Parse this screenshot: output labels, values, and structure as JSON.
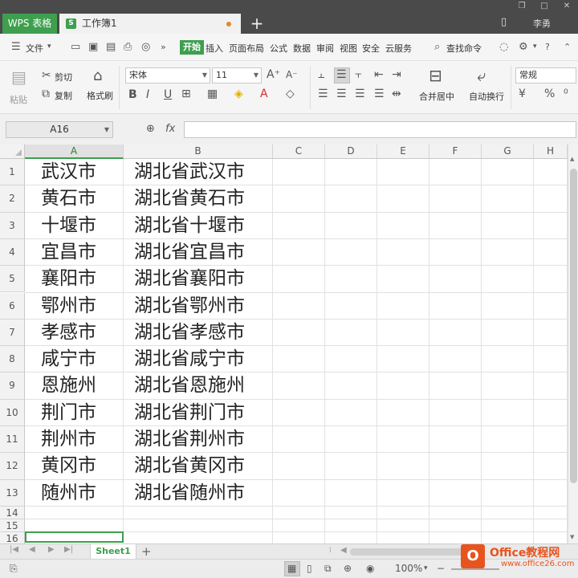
{
  "titlebar": {
    "app_tab": "WPS 表格",
    "doc_tab": "工作簿1",
    "new_tab": "+",
    "user": "李勇"
  },
  "menubar": {
    "file": "文件",
    "start": "开始",
    "items": [
      "插入",
      "页面布局",
      "公式",
      "数据",
      "审阅",
      "视图",
      "安全",
      "云服务"
    ],
    "search": "查找命令"
  },
  "ribbon": {
    "paste": "粘贴",
    "cut": "剪切",
    "copy": "复制",
    "format_painter": "格式刷",
    "font_name": "宋体",
    "font_size": "11",
    "merge_center": "合并居中",
    "wrap_text": "自动换行",
    "number_format": "常规",
    "bold": "B",
    "italic": "I",
    "underline": "U",
    "percent": "%"
  },
  "formulabar": {
    "name_box": "A16",
    "fx": "fx",
    "value": ""
  },
  "sheet": {
    "columns": [
      "A",
      "B",
      "C",
      "D",
      "E",
      "F",
      "G",
      "H"
    ],
    "rows": [
      "1",
      "2",
      "3",
      "4",
      "5",
      "6",
      "7",
      "8",
      "9",
      "10",
      "11",
      "12",
      "13",
      "14",
      "15",
      "16"
    ],
    "col_a": [
      "武汉市",
      "黄石市",
      "十堰市",
      "宜昌市",
      "襄阳市",
      "鄂州市",
      "孝感市",
      "咸宁市",
      "恩施州",
      "荆门市",
      "荆州市",
      "黄冈市",
      "随州市"
    ],
    "col_b": [
      "湖北省武汉市",
      "湖北省黄石市",
      "湖北省十堰市",
      "湖北省宜昌市",
      "湖北省襄阳市",
      "湖北省鄂州市",
      "湖北省孝感市",
      "湖北省咸宁市",
      "湖北省恩施州",
      "湖北省荆门市",
      "湖北省荆州市",
      "湖北省黄冈市",
      "湖北省随州市"
    ],
    "active_cell": "A16"
  },
  "tabs": {
    "sheet1": "Sheet1",
    "add": "+"
  },
  "statusbar": {
    "zoom": "100%"
  },
  "watermark": {
    "line1": "Office教程网",
    "line2": "www.office26.com"
  },
  "colors": {
    "accent": "#3e9f4f",
    "titlebar": "#4a4a4a",
    "watermark": "#e8541e"
  }
}
